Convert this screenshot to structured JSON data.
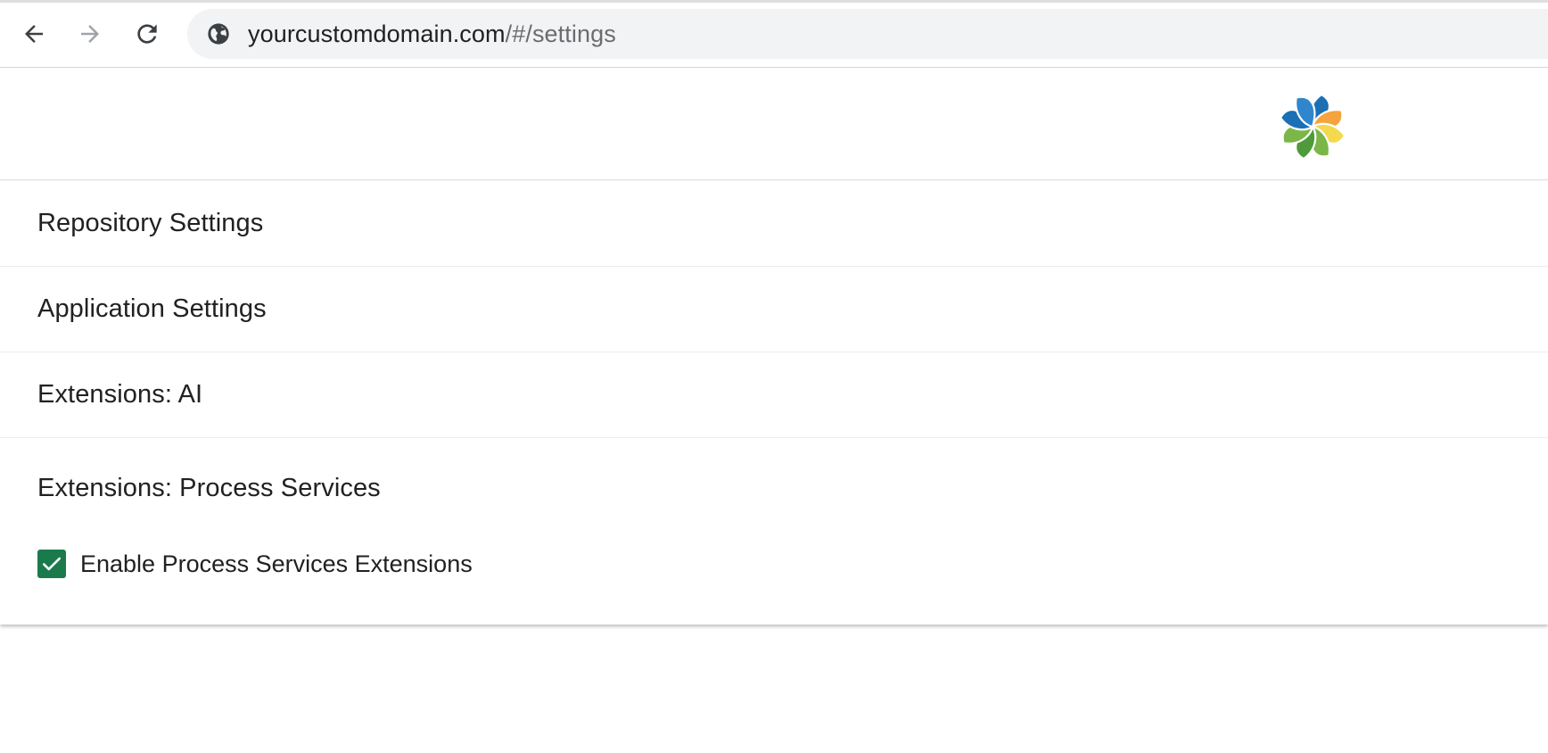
{
  "browser": {
    "url_host": "yourcustomdomain.com",
    "url_path": "/#/settings"
  },
  "settings": {
    "sections": [
      {
        "title": "Repository Settings"
      },
      {
        "title": "Application Settings"
      },
      {
        "title": "Extensions: AI"
      },
      {
        "title": "Extensions: Process Services"
      }
    ],
    "process_services": {
      "checkbox_label": "Enable Process Services Extensions",
      "checked": true
    }
  },
  "colors": {
    "checkbox_checked": "#1a7a4c",
    "logo_blue": "#1a6fb5",
    "logo_orange": "#f5a33c",
    "logo_yellow": "#f2d94e",
    "logo_green": "#7ab648",
    "logo_dark_green": "#4f9a3a"
  },
  "icons": [
    "back-arrow-icon",
    "forward-arrow-icon",
    "reload-icon",
    "site-info-icon",
    "app-logo",
    "checkmark-icon"
  ]
}
